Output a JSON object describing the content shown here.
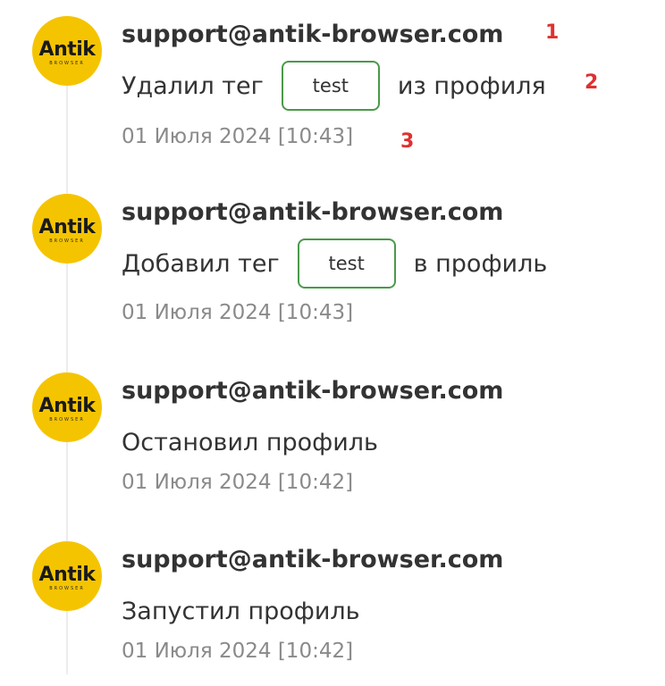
{
  "brand": {
    "avatar_color": "#f5c400",
    "tag_border_color": "#4a9a4a",
    "marker_color": "#e03030",
    "logo_text": "Antik",
    "logo_sub": "BROWSER"
  },
  "entries": [
    {
      "author": "support@antik-browser.com",
      "action_before": "Удалил тег",
      "tag": "test",
      "action_after": "из профиля",
      "date": "01 Июля 2024 [10:43]"
    },
    {
      "author": "support@antik-browser.com",
      "action_before": "Добавил тег",
      "tag": "test",
      "action_after": "в профиль",
      "date": "01 Июля 2024 [10:43]"
    },
    {
      "author": "support@antik-browser.com",
      "action_before": "Остановил профиль",
      "date": "01 Июля 2024 [10:42]"
    },
    {
      "author": "support@antik-browser.com",
      "action_before": "Запустил профиль",
      "date": "01 Июля 2024 [10:42]"
    }
  ],
  "markers": [
    "1",
    "2",
    "3"
  ]
}
